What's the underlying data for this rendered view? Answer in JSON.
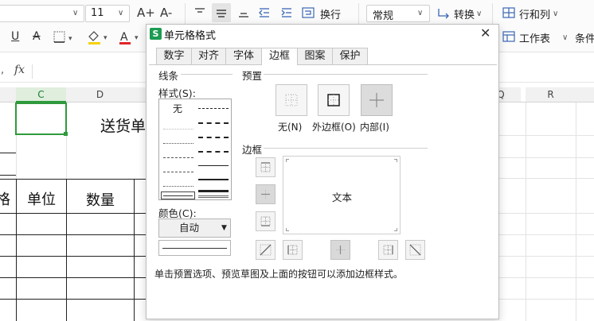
{
  "ribbon": {
    "font_size": "11",
    "grow_font_icon": "A+",
    "shrink_font_icon": "A-",
    "wrap_label": "换行",
    "number_format": "常规",
    "convert_label": "转换",
    "rowcol_label": "行和列",
    "worksheet_label": "工作表",
    "cond_label": "条件",
    "underline_icon": "U",
    "strike_icon": "A",
    "font_color_icon": "A"
  },
  "formula_bar": {
    "fx": "fx",
    "cell_ref_fragment": ","
  },
  "sheet": {
    "columns": [
      "C",
      "D",
      "Q",
      "R"
    ],
    "selected_column": "C",
    "title_fragment": "送货单",
    "header_cells": [
      "格",
      "单位",
      "数量"
    ]
  },
  "dialog": {
    "title": "单元格格式",
    "app_icon": "S",
    "close": "✕",
    "tabs": [
      "数字",
      "对齐",
      "字体",
      "边框",
      "图案",
      "保护"
    ],
    "active_tab": "边框",
    "line_group": "线条",
    "style_label": "样式(S):",
    "style_none": "无",
    "color_label": "颜色(C):",
    "color_value": "自动",
    "preset_group": "预置",
    "presets": [
      "无(N)",
      "外边框(O)",
      "内部(I)"
    ],
    "border_group": "边框",
    "preview_text": "文本",
    "hint": "单击预置选项、预览草图及上面的按钮可以添加边框样式。"
  }
}
